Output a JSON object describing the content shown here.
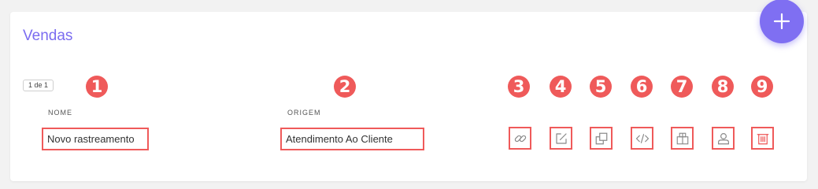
{
  "panel": {
    "title": "Vendas",
    "pagination": "1 de 1"
  },
  "fab": {
    "icon": "plus-icon"
  },
  "table": {
    "columns": [
      "NOME",
      "ORIGEM"
    ],
    "rows": [
      {
        "nome": "Novo rastreamento",
        "origem": "Atendimento Ao Cliente"
      }
    ]
  },
  "actions": [
    {
      "icon": "link-icon"
    },
    {
      "icon": "edit-icon"
    },
    {
      "icon": "copy-icon"
    },
    {
      "icon": "code-icon"
    },
    {
      "icon": "package-icon"
    },
    {
      "icon": "user-icon"
    },
    {
      "icon": "trash-icon"
    }
  ],
  "markers": [
    "1",
    "2",
    "3",
    "4",
    "5",
    "6",
    "7",
    "8",
    "9"
  ],
  "colors": {
    "accent": "#7b6cf0",
    "fab": "#7f6ff2",
    "annotation": "#ef5a5a"
  }
}
